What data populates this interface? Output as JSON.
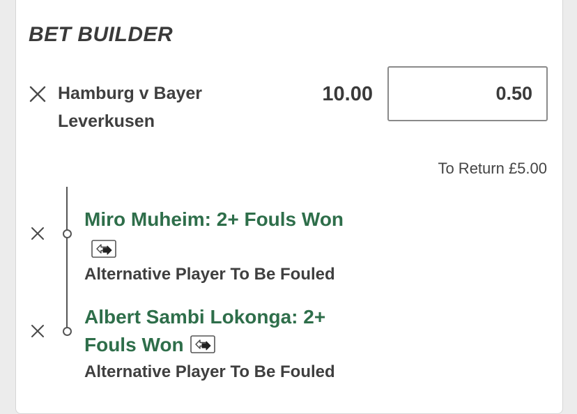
{
  "bet_builder": {
    "title": "BET BUILDER",
    "event": {
      "name": "Hamburg v Bayer Leverkusen",
      "odds": "10.00",
      "stake": "0.50"
    },
    "to_return": "To Return £5.00",
    "selections": [
      {
        "name": "Miro Muheim: 2+ Fouls Won",
        "market": "Alternative Player To Be Fouled",
        "swap_icon": "swap-arrows-icon"
      },
      {
        "name": "Albert Sambi Lokonga: 2+ Fouls Won",
        "market": "Alternative Player To Be Fouled",
        "swap_icon": "swap-arrows-icon"
      }
    ]
  },
  "colors": {
    "selection_green": "#2e6e4a",
    "text_dark": "#3a3a3a",
    "card_background": "#ffffff",
    "page_background": "#ececec"
  }
}
